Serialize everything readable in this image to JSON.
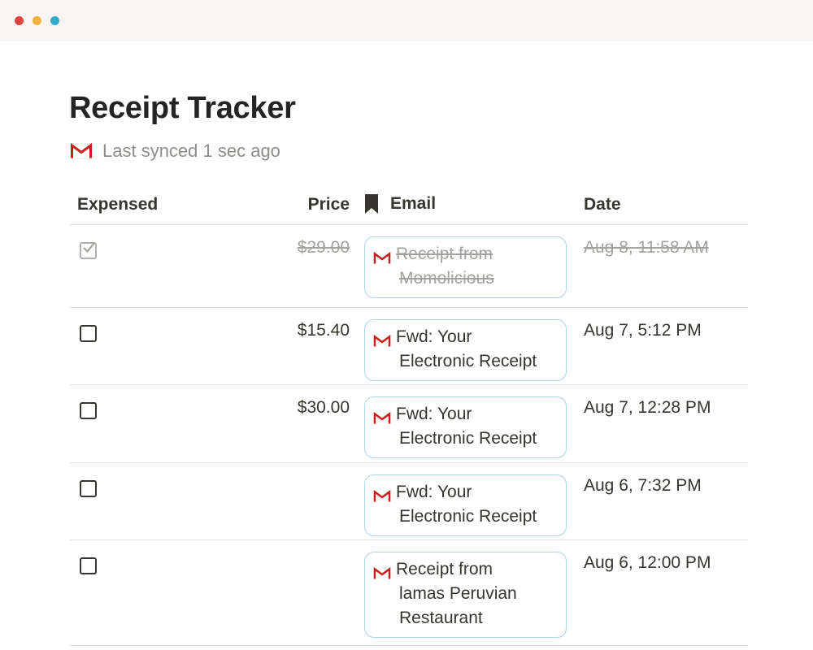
{
  "window": {
    "controls": [
      "close",
      "minimize",
      "maximize"
    ]
  },
  "page": {
    "title": "Receipt Tracker",
    "sync_status": "Last synced 1 sec ago",
    "sync_icon": "gmail-icon"
  },
  "table": {
    "columns": {
      "expensed": "Expensed",
      "price": "Price",
      "email": "Email",
      "email_icon": "bookmark-icon",
      "date": "Date"
    },
    "rows": [
      {
        "expensed": true,
        "price": "$29.00",
        "email_line1": "Receipt from",
        "email_line2": "Momolicious",
        "email_line3": "",
        "date": "Aug 8, 11:58 AM"
      },
      {
        "expensed": false,
        "price": "$15.40",
        "email_line1": "Fwd: Your",
        "email_line2": "Electronic Receipt",
        "email_line3": "",
        "date": "Aug 7, 5:12 PM"
      },
      {
        "expensed": false,
        "price": "$30.00",
        "email_line1": "Fwd: Your",
        "email_line2": "Electronic Receipt",
        "email_line3": "",
        "date": "Aug 7, 12:28 PM"
      },
      {
        "expensed": false,
        "price": "",
        "email_line1": "Fwd: Your",
        "email_line2": "Electronic Receipt",
        "email_line3": "",
        "date": "Aug 6, 7:32 PM"
      },
      {
        "expensed": false,
        "price": "",
        "email_line1": "Receipt from",
        "email_line2": "lamas Peruvian",
        "email_line3": "Restaurant",
        "date": "Aug 6, 12:00 PM"
      }
    ]
  },
  "colors": {
    "title_text": "#242424",
    "muted_text": "#8d8d8a",
    "chip_border": "#a9d4e3",
    "gmail_red": "#c5221f",
    "divider": "#e3e2df"
  }
}
